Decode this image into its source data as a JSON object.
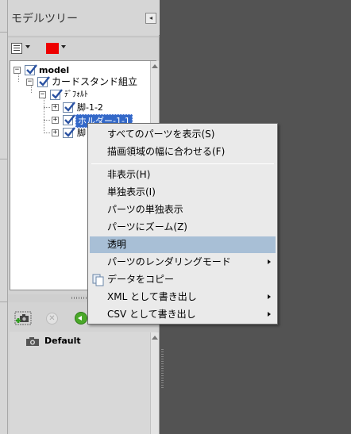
{
  "panel": {
    "title": "モデルツリー",
    "collapse_glyph": "◂"
  },
  "colors": {
    "selection": "#3368c8",
    "menu_highlight": "#a8bfd6",
    "swatch": "#ee0000",
    "canvas": "#535353"
  },
  "tree": {
    "root": "model",
    "assembly": "カードスタンド組立",
    "default_view": "ﾃﾞﾌｫﾙﾄ",
    "leg_1": "脚-1-2",
    "holder": "ホルダー-1-1",
    "leg_2": "脚"
  },
  "views": {
    "items": [
      {
        "label": "Default"
      }
    ]
  },
  "context_menu": {
    "items": [
      {
        "label": "すべてのパーツを表示(S)"
      },
      {
        "label": "描画領域の幅に合わせる(F)"
      },
      {
        "label": "非表示(H)"
      },
      {
        "label": "単独表示(I)"
      },
      {
        "label": "パーツの単独表示"
      },
      {
        "label": "パーツにズーム(Z)"
      },
      {
        "label": "透明"
      },
      {
        "label": "パーツのレンダリングモード"
      },
      {
        "label": "データをコピー"
      },
      {
        "label": "XML として書き出し"
      },
      {
        "label": "CSV として書き出し"
      }
    ]
  },
  "icons": {
    "collapse": "collapse-panel-icon",
    "list": "list-view-icon",
    "color": "color-swatch-icon",
    "add_camera": "add-view-icon",
    "delete": "delete-icon",
    "go": "go-to-view-icon",
    "camera": "camera-icon",
    "copy": "copy-icon"
  }
}
